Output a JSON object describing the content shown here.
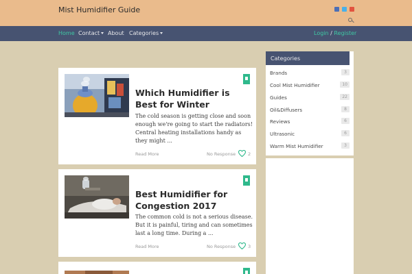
{
  "site": {
    "title": "Mist Humidifier Guide"
  },
  "social": [
    "facebook-icon",
    "twitter-icon",
    "googleplus-icon"
  ],
  "nav": {
    "home": "Home",
    "contact": "Contact",
    "about": "About",
    "categories": "Categories",
    "login": "Login",
    "separator": "/",
    "register": "Register"
  },
  "posts": [
    {
      "title": "Which Humidifier is Best for Winter",
      "excerpt": "The cold season is getting close and soon enough we're going to start the radiators! Central heating installations handy as they might ...",
      "read_more": "Read More",
      "responses": "No Response",
      "likes": "2"
    },
    {
      "title": "Best Humidifier for Congestion 2017",
      "excerpt": "The common cold is not a serious disease. But it is painful, tiring and can sometimes last a long time. During a ...",
      "read_more": "Read More",
      "responses": "No Response",
      "likes": "3"
    }
  ],
  "sidebar": {
    "heading": "Categories",
    "items": [
      {
        "label": "Brands",
        "count": "3"
      },
      {
        "label": "Cool Mist Humidifier",
        "count": "10"
      },
      {
        "label": "Guides",
        "count": "22"
      },
      {
        "label": "Oil&Diffusers",
        "count": "8"
      },
      {
        "label": "Reviews",
        "count": "6"
      },
      {
        "label": "Ultrasonic",
        "count": "6"
      },
      {
        "label": "Warm Mist Humidifier",
        "count": "3"
      }
    ]
  },
  "colors": {
    "topbar": "#eabb8c",
    "navbar": "#475371",
    "accent": "#3fc9a4",
    "bookmark": "#2fb98c",
    "page_bg": "#d9ceb1"
  }
}
